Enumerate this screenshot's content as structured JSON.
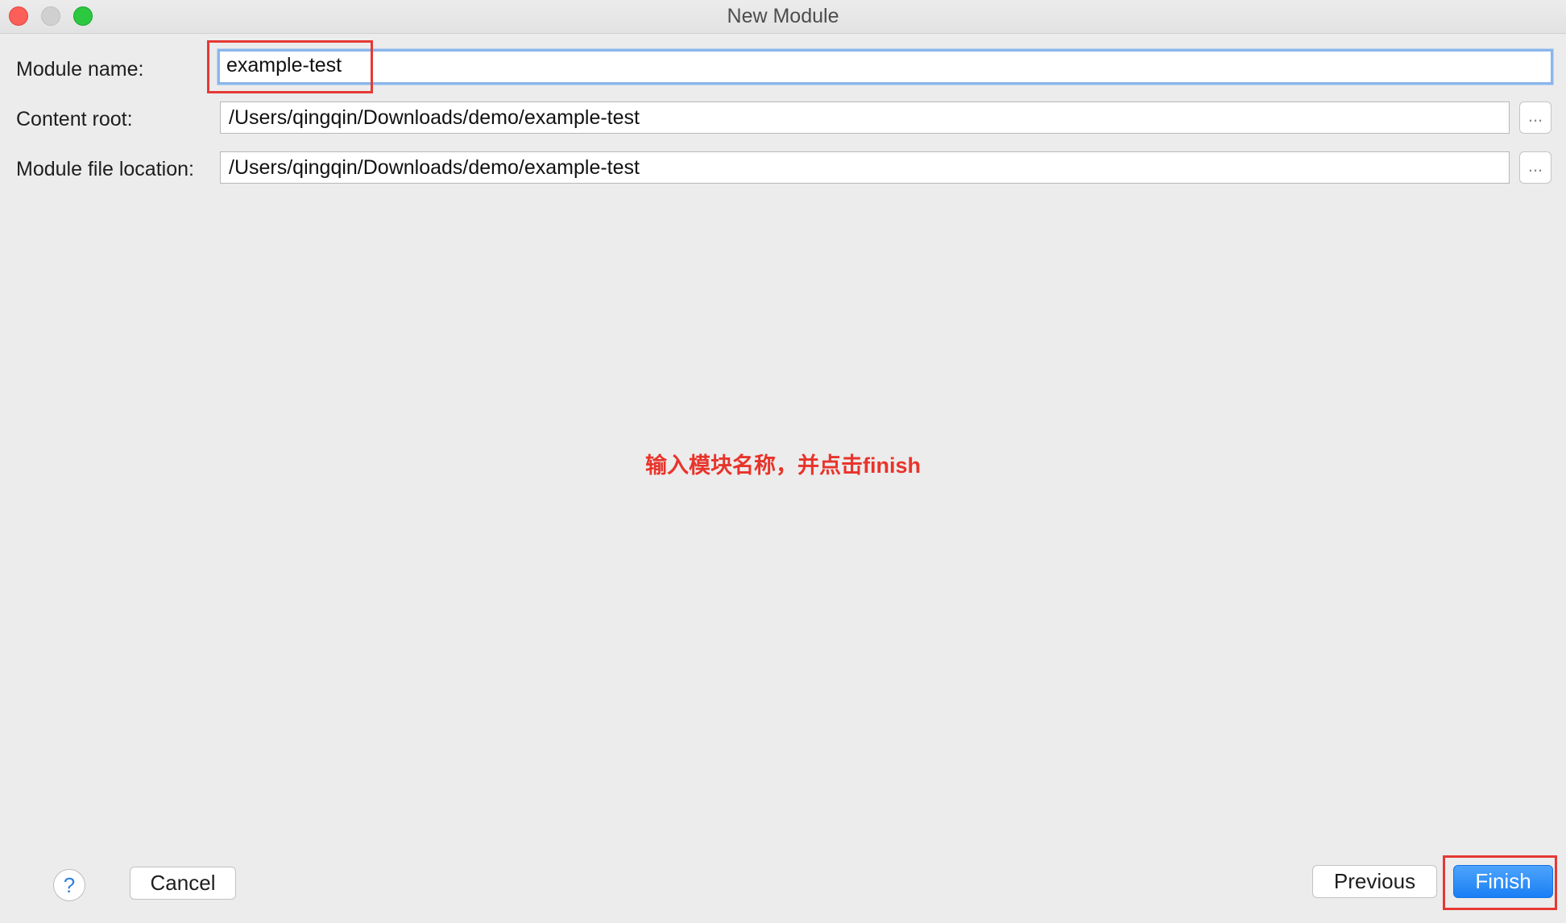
{
  "window": {
    "title": "New Module"
  },
  "form": {
    "module_name": {
      "label": "Module name:",
      "value": "example-test"
    },
    "content_root": {
      "label": "Content root:",
      "value": "/Users/qingqin/Downloads/demo/example-test",
      "browse_label": "..."
    },
    "module_file_location": {
      "label": "Module file location:",
      "value": "/Users/qingqin/Downloads/demo/example-test",
      "browse_label": "..."
    }
  },
  "annotation": {
    "text": "输入模块名称，并点击finish",
    "color": "#e8342b"
  },
  "footer": {
    "help_label": "?",
    "cancel_label": "Cancel",
    "previous_label": "Previous",
    "finish_label": "Finish"
  },
  "colors": {
    "accent": "#1a7ff5",
    "highlight": "#e53935"
  }
}
